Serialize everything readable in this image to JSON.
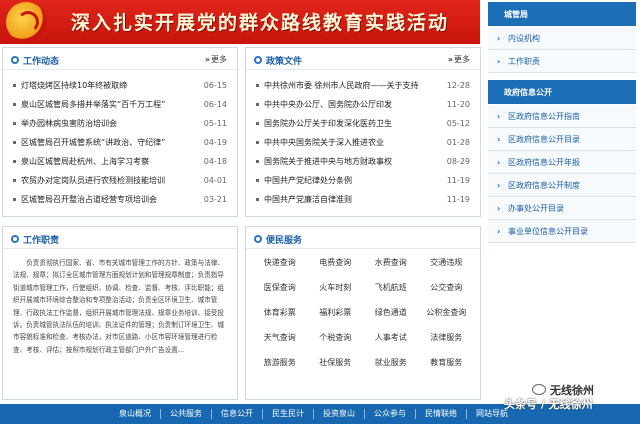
{
  "banner": {
    "title": "深入扎实开展党的群众路线教育实践活动"
  },
  "work_news": {
    "title": "工作动态",
    "more": "更多",
    "items": [
      {
        "text": "灯塔烧烤区持续10年终被取缔",
        "date": "06-15"
      },
      {
        "text": "泉山区城管局多措并举落实“百千万工程”",
        "date": "06-14"
      },
      {
        "text": "举办园林病虫害防治培训会",
        "date": "05-11"
      },
      {
        "text": "区城管局召开城管系统“讲政治、守纪律”",
        "date": "04-19"
      },
      {
        "text": "泉山区城管局赴杭州、上海学习考察",
        "date": "04-18"
      },
      {
        "text": "农贸办对定岗队员进行农残检测技能培训",
        "date": "04-01"
      },
      {
        "text": "区城管局召开整治占道经营专项培训会",
        "date": "03-21"
      }
    ]
  },
  "policy": {
    "title": "政策文件",
    "more": "更多",
    "items": [
      {
        "text": "中共徐州市委 徐州市人民政府——关于支持",
        "date": "12-28"
      },
      {
        "text": "中共中央办公厅、国务院办公厅印发",
        "date": "11-20"
      },
      {
        "text": "国务院办公厅关于印发深化医药卫生",
        "date": "05-12"
      },
      {
        "text": "中共中央国务院关于深入推进农业",
        "date": "01-28"
      },
      {
        "text": "国务院关于推进中央与地方财政事权",
        "date": "08-29"
      },
      {
        "text": "中国共产党纪律处分条例",
        "date": "11-19"
      },
      {
        "text": "中国共产党廉洁自律准则",
        "date": "11-19"
      }
    ]
  },
  "duty": {
    "title": "工作职责",
    "text": "负责贯彻执行国家、省、市有关城市管理工作的方针、政策与法律、法规、规章；拟订全区城市管理方面规划计划和管理规章制度；负责指导街道城市管理工作，行使组织、协调、检查、监督、考核、评比职能；组织开展城市环境综合整治和专项整治活动；负责全区环境卫生、城市管理、行政执法工作监督，组织开展城市管理法规、规章业务培训、接受投诉。负责城管执法队伍的培训、执法证件的管理；负责制订环境卫生、城市容貌标准和检查、考核办法，对市区道路、小区市容环境管理进行检查、考核、评估；按照市规划行政主管部门户外广告设置..."
  },
  "services": {
    "title": "便民服务",
    "items": [
      "快递查询",
      "电费查询",
      "水费查询",
      "交通违规",
      "医保查询",
      "火车时刻",
      "飞机航班",
      "公交查询",
      "体育彩票",
      "福利彩票",
      "绿色通道",
      "公积金查询",
      "天气查询",
      "个税查询",
      "人事考试",
      "法律服务",
      "旅游服务",
      "社保服务",
      "就业服务",
      "教育服务"
    ]
  },
  "sidebar": {
    "bureau_title": "城管局",
    "bureau_items": [
      "内设机构",
      "工作职责"
    ],
    "info_title": "政府信息公开",
    "info_items": [
      "区政府信息公开指南",
      "区政府信息公开目录",
      "区政府信息公开年报",
      "区政府信息公开制度",
      "办事处公开目录",
      "事业单位信息公开目录"
    ]
  },
  "footer": {
    "links": [
      "泉山概况",
      "公共服务",
      "信息公开",
      "民生民计",
      "投资泉山",
      "公众参与",
      "民情联络",
      "网站导航"
    ]
  },
  "watermark": {
    "line1": "无线徐州",
    "line2": "头条号 / 无线徐州"
  },
  "colors": {
    "banner_red": "#d01e15",
    "accent_blue": "#1c6fb7",
    "link_blue": "#1a5fa8"
  }
}
